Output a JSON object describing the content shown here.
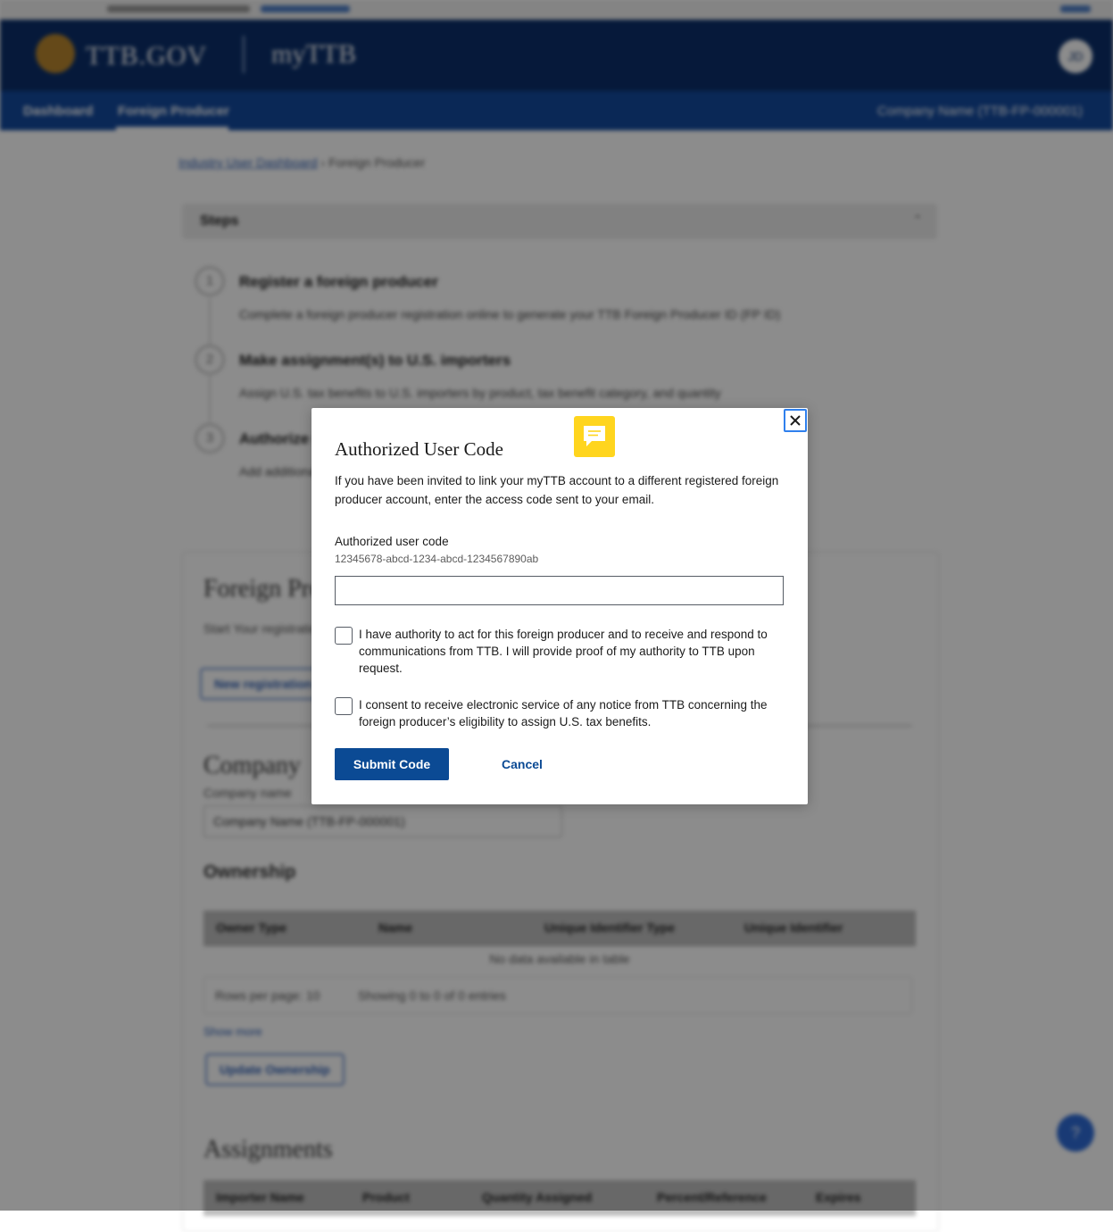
{
  "header": {
    "brand": "TTB.GOV",
    "app_name": "myTTB",
    "avatar_initials": "JD"
  },
  "nav": {
    "items": [
      "Dashboard",
      "Foreign Producer"
    ],
    "company": "Company Name (TTB-FP-000001)"
  },
  "breadcrumb": {
    "home": "Industry User Dashboard",
    "separator": "›",
    "current": "Foreign Producer"
  },
  "steps_accordion": {
    "title": "Steps"
  },
  "steps": [
    {
      "number": "1",
      "title": "Register a foreign producer",
      "desc": "Complete a foreign producer registration online to generate your TTB Foreign Producer ID (FP ID)"
    },
    {
      "number": "2",
      "title": "Make assignment(s) to U.S. importers",
      "desc": "Assign U.S. tax benefits to U.S. importers by product, tax benefit category, and quantity"
    },
    {
      "number": "3",
      "title": "Authorize users",
      "desc": "Add additional users"
    }
  ],
  "foreign_producer": {
    "heading": "Foreign Producers",
    "desc": "Start Your registration here. You can also link your account to additional registered foreign producers.",
    "new_button": "New registration"
  },
  "company": {
    "heading": "Company",
    "label": "Company name",
    "selected": "Company Name (TTB-FP-000001)"
  },
  "ownership": {
    "heading": "Ownership",
    "columns": [
      "Owner Type",
      "Name",
      "Unique Identifier Type",
      "Unique Identifier"
    ],
    "empty": "No data available in table",
    "rows_per_page": "Rows per page: 10",
    "showing": "Showing 0 to 0 of 0 entries",
    "more": "Show more",
    "update_button": "Update Ownership"
  },
  "assignments": {
    "heading": "Assignments",
    "columns": [
      "Importer Name",
      "Product",
      "Quantity Assigned",
      "Percent/Reference",
      "Expires"
    ]
  },
  "modal": {
    "title": "Authorized User Code",
    "description": "If you have been invited to link your myTTB account to a different registered foreign producer account, enter the access code sent to your email.",
    "code_label": "Authorized user code",
    "code_hint": "12345678-abcd-1234-abcd-1234567890ab",
    "code_value": "",
    "checkbox_authority": "I have authority to act for this foreign producer and to receive and respond to communications from TTB. I will provide proof of my authority to TTB upon request.",
    "checkbox_consent": "I consent to receive electronic service of any notice from TTB concerning the foreign producer’s eligibility to assign U.S. tax benefits.",
    "submit_label": "Submit Code",
    "cancel_label": "Cancel"
  },
  "icons": {
    "close": "close-icon",
    "feedback": "feedback-chat-icon",
    "help": "help-icon"
  },
  "colors": {
    "primary": "#0b4a94",
    "header": "#0b2f6b",
    "nav": "#13499d",
    "focus": "#2f80ed",
    "feedback": "#ffd51e"
  }
}
